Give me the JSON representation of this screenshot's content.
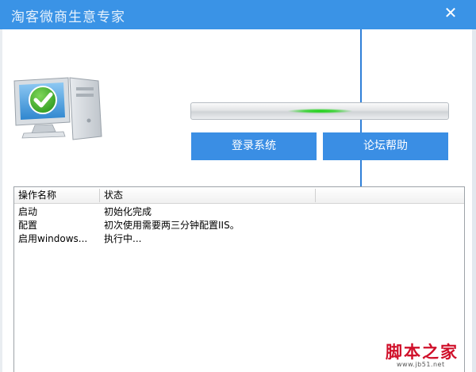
{
  "window": {
    "title": "淘客微商生意专家",
    "close_glyph": "✕"
  },
  "progress": {
    "value_percent": 50,
    "highlight_color": "#17d10f"
  },
  "buttons": {
    "login": "登录系统",
    "forum_help": "论坛帮助"
  },
  "table": {
    "columns": [
      "操作名称",
      "状态",
      ""
    ],
    "rows": [
      {
        "name": "启动",
        "status": "初始化完成"
      },
      {
        "name": "配置",
        "status": "初次使用需要两三分钟配置IIS。"
      },
      {
        "name": "启用windows...",
        "status": "执行中..."
      }
    ]
  },
  "watermark": {
    "text": "脚本之家",
    "url": "www.jb51.net"
  },
  "colors": {
    "titlebar": "#3a93e6",
    "button": "#3a8ee4",
    "check_green": "#4caf2f"
  }
}
